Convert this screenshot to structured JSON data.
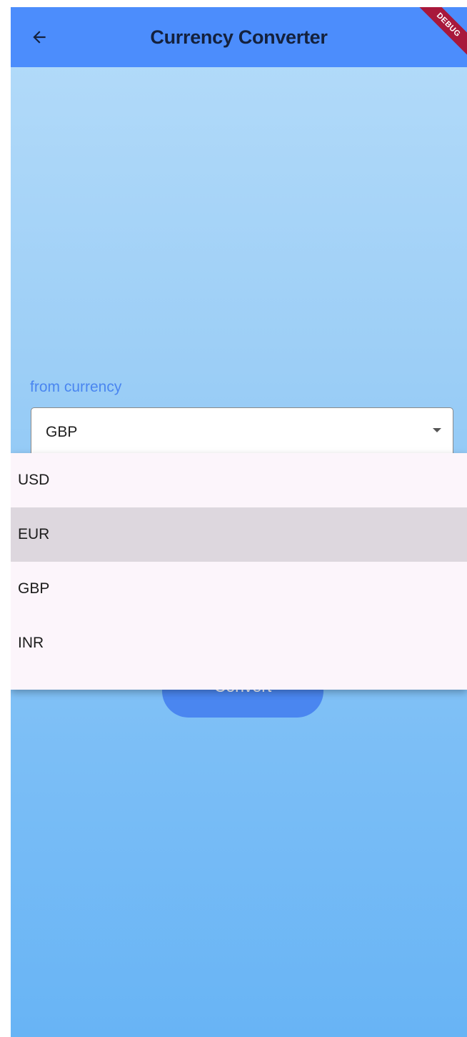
{
  "app_bar": {
    "title": "Currency Converter",
    "back_icon": "arrow-left-icon",
    "background_color": "#4c8dfc",
    "debug_banner": "DEBUG"
  },
  "form": {
    "from_currency": {
      "label": "from currency",
      "selected_value": "GBP",
      "arrow_icon": "dropdown-arrow-icon"
    },
    "convert_button": {
      "label": "Convert",
      "color": "#4a86f0"
    }
  },
  "dropdown_menu": {
    "highlighted_index": 1,
    "items": [
      {
        "label": "USD"
      },
      {
        "label": "EUR"
      },
      {
        "label": "GBP"
      },
      {
        "label": "INR"
      }
    ]
  },
  "colors": {
    "accent": "#4a86f0",
    "gradient_top": "#b5dcfa",
    "gradient_bottom": "#68b4f5",
    "menu_background": "#fcf5fb",
    "menu_highlight": "#ddd7de"
  }
}
